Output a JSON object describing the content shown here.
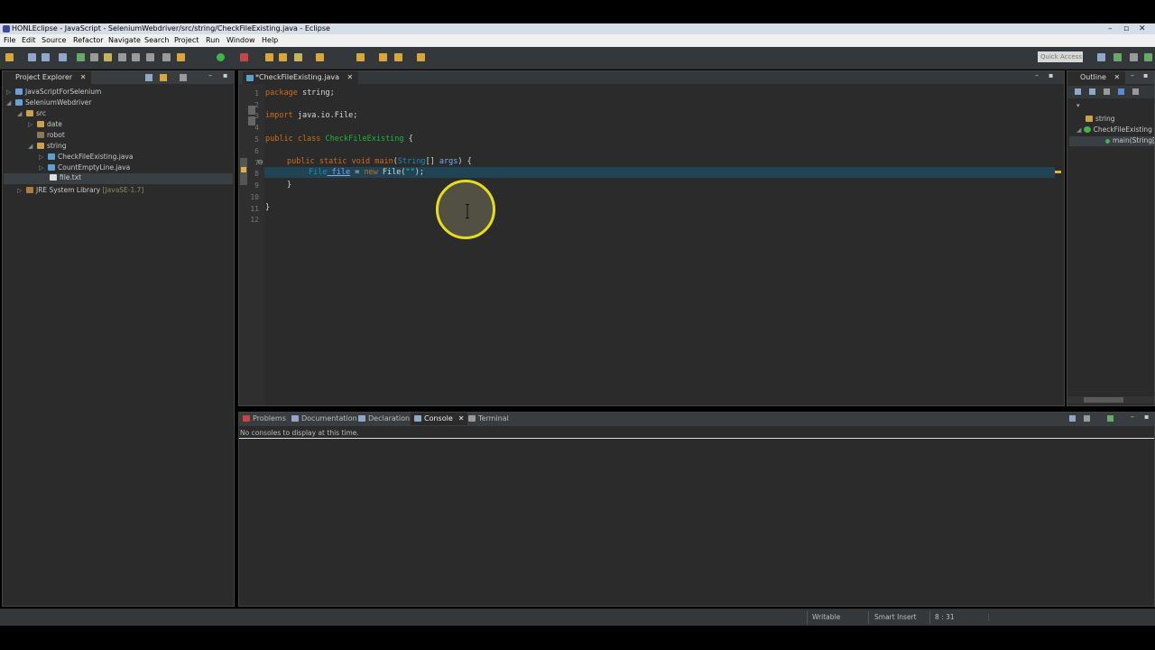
{
  "window": {
    "title": "HONLEclipse - JavaScript - SeleniumWebdriver/src/string/CheckFileExisting.java - Eclipse"
  },
  "menu": [
    "File",
    "Edit",
    "Source",
    "Refactor",
    "Navigate",
    "Search",
    "Project",
    "Run",
    "Window",
    "Help"
  ],
  "toolbar": {
    "quick_access": "Quick Access"
  },
  "project_explorer": {
    "tab_label": "Project Explorer",
    "items": [
      {
        "label": "JavaScriptForSelenium"
      },
      {
        "label": "SeleniumWebdriver"
      },
      {
        "label": "src"
      },
      {
        "label": "date"
      },
      {
        "label": "robot"
      },
      {
        "label": "string"
      },
      {
        "label": "CheckFileExisting.java"
      },
      {
        "label": "CountEmptyLine.java"
      },
      {
        "label": "file.txt"
      },
      {
        "label": "JRE System Library",
        "suffix": "[JavaSE-1.7]"
      }
    ]
  },
  "editor": {
    "tab_label": "*CheckFileExisting.java",
    "line_numbers": [
      "1",
      "2",
      "3",
      "4",
      "5",
      "6",
      "7",
      "8",
      "9",
      "10",
      "11",
      "12"
    ],
    "code": {
      "l1_kw": "package",
      "l1_rest": " string;",
      "l3_kw": "import",
      "l3_rest": " java.io.File;",
      "l5_kw": "public class",
      "l5_cls": " CheckFileExisting",
      "l5_rest": " {",
      "l7_kw": "public static void",
      "l7_m": " main",
      "l7_a": "(",
      "l7_t": "String",
      "l7_b": "[] ",
      "l7_v": "args",
      "l7_c": ") {",
      "l8_t": "File",
      "l8_v": " file",
      "l8_a": " = ",
      "l8_kw": "new",
      "l8_b": " File(",
      "l8_s": "\"\"",
      "l8_c": ");",
      "l9": "}",
      "l11": "}"
    }
  },
  "outline": {
    "tab_label": "Outline",
    "items": [
      "string",
      "CheckFileExisting",
      "main(String[]"
    ]
  },
  "bottom_panel": {
    "tabs": [
      "Problems",
      "Documentation",
      "Declaration",
      "Console",
      "Terminal"
    ],
    "message": "No consoles to display at this time."
  },
  "status": {
    "writable": "Writable",
    "insert_mode": "Smart Insert",
    "position": "8 : 31"
  },
  "colors": {
    "accent_keyword": "#cc6c1d",
    "class_name": "#1eb540",
    "cursor_ring": "#e6dd1a"
  }
}
